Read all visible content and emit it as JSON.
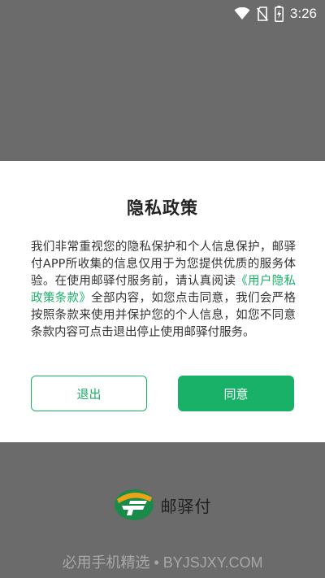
{
  "status_bar": {
    "time": "3:26",
    "icons": [
      "wifi-icon",
      "no-sim-icon",
      "battery-charging-icon"
    ]
  },
  "dialog": {
    "title": "隐私政策",
    "body_before_link": "我们非常重视您的隐私保护和个人信息保护，邮驿付APP所收集的信息仅用于为您提供优质的服务体验。在使用邮驿付服务前，请认真阅读",
    "link_text": "《用户隐私政策条款》",
    "body_after_link": "全部内容，如您点击同意，我们会严格按照条款来使用并保护您的个人信息，如您不同意条款内容可点击退出停止使用邮驿付服务。",
    "exit_label": "退出",
    "agree_label": "同意"
  },
  "brand": {
    "name": "邮驿付",
    "logo_icon": "youyifu-logo-icon"
  },
  "watermark": "必用手机精选 • BYJSJXY.COM",
  "colors": {
    "accent": "#19b167",
    "overlay": "#6b6b6b",
    "dialog_bg": "#ffffff"
  }
}
